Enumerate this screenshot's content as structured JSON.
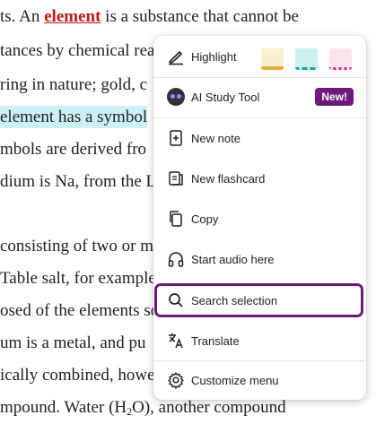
{
  "document": {
    "lines": [
      {
        "parts": [
          {
            "t": "ts. An "
          },
          {
            "t": "element",
            "cls": "link"
          },
          {
            "t": " is a substance that cannot be"
          }
        ]
      },
      {
        "parts": [
          {
            "t": "tances by chemical rea"
          }
        ]
      },
      {
        "parts": [
          {
            "t": "ring in nature; gold, c"
          }
        ]
      },
      {
        "parts": [
          {
            "t": " element has a symbol",
            "cls": "hl-bg"
          }
        ]
      },
      {
        "parts": [
          {
            "t": "mbols are derived fro"
          }
        ]
      },
      {
        "parts": [
          {
            "t": "dium is "
          },
          {
            "t": "Na"
          },
          {
            "t": ", from the L"
          }
        ]
      },
      {
        "parts": [
          {
            "t": ""
          }
        ]
      },
      {
        "parts": [
          {
            "t": " consisting of two or m"
          }
        ]
      },
      {
        "parts": [
          {
            "t": "Table salt, for example"
          }
        ]
      },
      {
        "parts": [
          {
            "t": "osed of the elements so"
          }
        ]
      },
      {
        "parts": [
          {
            "t": "um is a metal, and pu"
          }
        ]
      },
      {
        "parts": [
          {
            "t": "ically combined, howe"
          }
        ]
      },
      {
        "parts": [
          {
            "t": "mpound. Water (H"
          },
          {
            "t": "2",
            "cls": "sub"
          },
          {
            "t": "O), another compound"
          }
        ]
      }
    ]
  },
  "menu": {
    "highlight_label": "Highlight",
    "swatch_colors": [
      "#fbefcf",
      "#cdf1f0",
      "#fce4ee"
    ],
    "swatch_underline_colors": [
      "#e9a93b",
      "#1aa3a3",
      "#e0257a"
    ],
    "ai_label": "AI Study Tool",
    "ai_badge": "New!",
    "items": [
      {
        "name": "new-note",
        "label": "New note",
        "icon": "note-plus-icon"
      },
      {
        "name": "new-flashcard",
        "label": "New flashcard",
        "icon": "flashcard-icon"
      },
      {
        "name": "copy",
        "label": "Copy",
        "icon": "copy-icon"
      },
      {
        "name": "start-audio",
        "label": "Start audio here",
        "icon": "headphones-icon"
      },
      {
        "name": "search-selection",
        "label": "Search selection",
        "icon": "search-icon"
      },
      {
        "name": "translate",
        "label": "Translate",
        "icon": "translate-icon"
      },
      {
        "name": "customize-menu",
        "label": "Customize menu",
        "icon": "gear-icon"
      }
    ],
    "selected_item": "search-selection"
  }
}
